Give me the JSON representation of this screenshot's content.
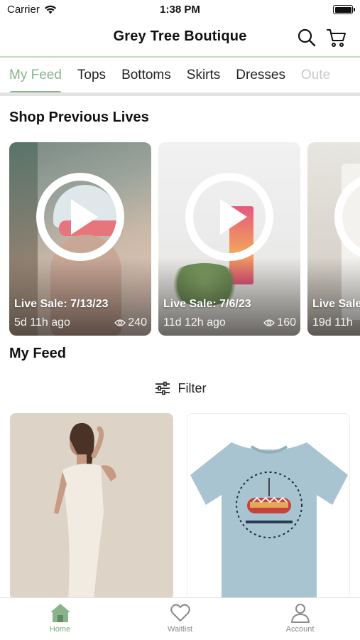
{
  "status_bar": {
    "carrier": "Carrier",
    "time": "1:38 PM"
  },
  "header": {
    "title": "Grey Tree Boutique"
  },
  "tabs": [
    {
      "label": "My Feed"
    },
    {
      "label": "Tops"
    },
    {
      "label": "Bottoms"
    },
    {
      "label": "Skirts"
    },
    {
      "label": "Dresses"
    },
    {
      "label": "Oute"
    }
  ],
  "lives_section": {
    "title": "Shop Previous Lives",
    "items": [
      {
        "title": "Live Sale: 7/13/23",
        "age": "5d 11h ago",
        "views": "240"
      },
      {
        "title": "Live Sale: 7/6/23",
        "age": "11d 12h ago",
        "views": "160"
      },
      {
        "title": "Live Sale",
        "age": "19d 11h",
        "views": ""
      }
    ]
  },
  "feed_section": {
    "title": "My Feed",
    "filter_label": "Filter"
  },
  "products": [
    {
      "name": "Off-shoulder dress"
    },
    {
      "name": "Graphic t-shirt"
    }
  ],
  "bottom_nav": [
    {
      "label": "Home",
      "icon": "home-icon"
    },
    {
      "label": "Waitlist",
      "icon": "heart-icon"
    },
    {
      "label": "Account",
      "icon": "user-icon"
    }
  ],
  "colors": {
    "accent": "#8ab38d",
    "tab_border": "#c9d7c4"
  }
}
